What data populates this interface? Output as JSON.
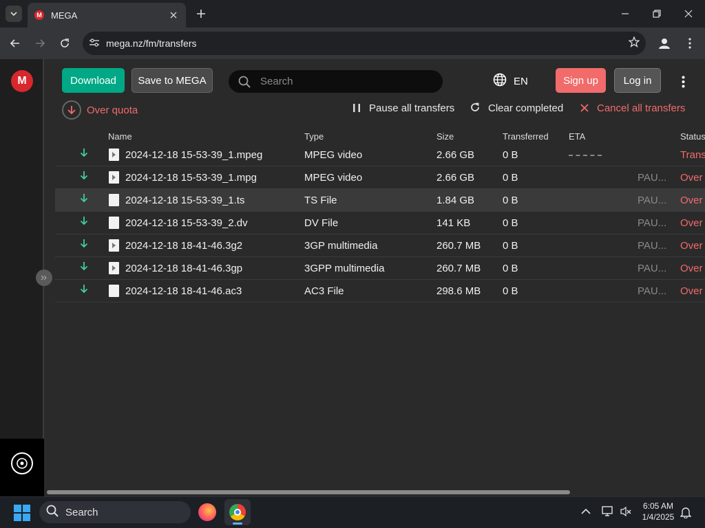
{
  "browser": {
    "tab_title": "MEGA",
    "tab_favicon": "M",
    "url": "mega.nz/fm/transfers",
    "icons": {
      "tab_list": "chevron-down-icon",
      "close_tab": "close-icon",
      "new_tab": "plus-icon",
      "back": "arrow-left-icon",
      "forward": "arrow-right-icon",
      "reload": "reload-icon",
      "site_info": "tune-icon",
      "bookmark": "star-icon",
      "profile": "person-icon",
      "menu": "kebab-icon"
    }
  },
  "header": {
    "logo": "M",
    "download_label": "Download",
    "save_label": "Save to MEGA",
    "search_placeholder": "Search",
    "language": "EN",
    "signup_label": "Sign up",
    "login_label": "Log in"
  },
  "actions": {
    "over_quota": "Over quota",
    "pause_all": "Pause all transfers",
    "clear_completed": "Clear completed",
    "cancel_all": "Cancel all transfers"
  },
  "table": {
    "columns": {
      "name": "Name",
      "type": "Type",
      "size": "Size",
      "transferred": "Transferred",
      "eta": "ETA",
      "status": "Status"
    },
    "rows": [
      {
        "name": "2024-12-18 15-53-39_1.mpeg",
        "type": "MPEG video",
        "size": "2.66 GB",
        "transferred": "0 B",
        "pause": "",
        "status": "Transf",
        "file_icon": "video"
      },
      {
        "name": "2024-12-18 15-53-39_1.mpg",
        "type": "MPEG video",
        "size": "2.66 GB",
        "transferred": "0 B",
        "pause": "PAU...",
        "status": "Over",
        "file_icon": "video"
      },
      {
        "name": "2024-12-18 15-53-39_1.ts",
        "type": "TS File",
        "size": "1.84 GB",
        "transferred": "0 B",
        "pause": "PAU...",
        "status": "Over",
        "file_icon": "generic"
      },
      {
        "name": "2024-12-18 15-53-39_2.dv",
        "type": "DV File",
        "size": "141 KB",
        "transferred": "0 B",
        "pause": "PAU...",
        "status": "Over",
        "file_icon": "generic"
      },
      {
        "name": "2024-12-18 18-41-46.3g2",
        "type": "3GP multimedia",
        "size": "260.7 MB",
        "transferred": "0 B",
        "pause": "PAU...",
        "status": "Over",
        "file_icon": "video"
      },
      {
        "name": "2024-12-18 18-41-46.3gp",
        "type": "3GPP multimedia",
        "size": "260.7 MB",
        "transferred": "0 B",
        "pause": "PAU...",
        "status": "Over",
        "file_icon": "video"
      },
      {
        "name": "2024-12-18 18-41-46.ac3",
        "type": "AC3 File",
        "size": "298.6 MB",
        "transferred": "0 B",
        "pause": "PAU...",
        "status": "Over",
        "file_icon": "generic"
      }
    ]
  },
  "taskbar": {
    "search_label": "Search",
    "time": "6:05 AM",
    "date": "1/4/2025"
  },
  "colors": {
    "accent_green": "#00a886",
    "accent_red": "#f16b6b",
    "mega_red": "#d9272e"
  }
}
